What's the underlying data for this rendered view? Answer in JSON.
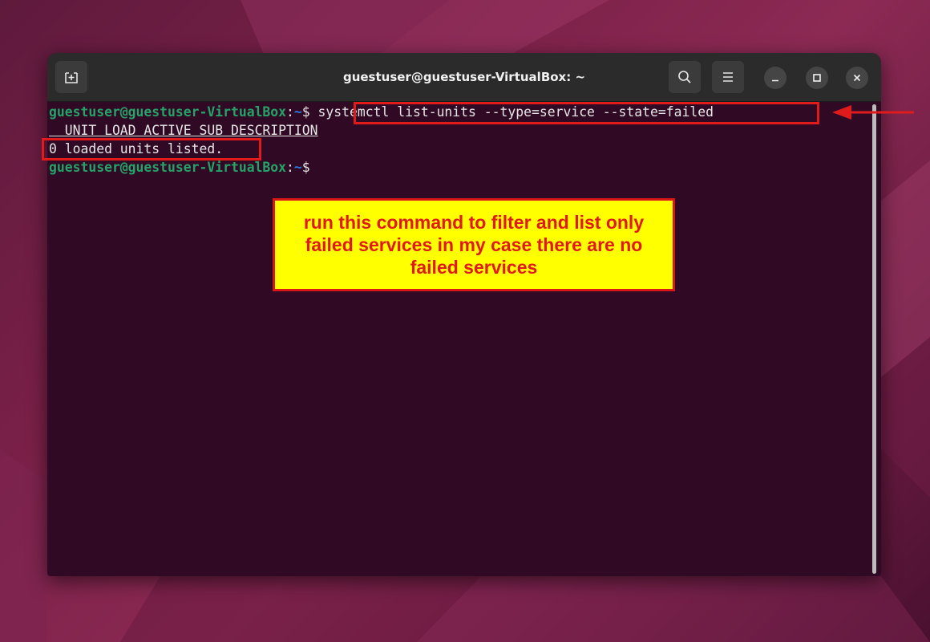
{
  "titlebar": {
    "title": "guestuser@guestuser-VirtualBox: ~",
    "new_tab_icon": "new-tab-icon",
    "search_icon": "search-icon",
    "menu_icon": "hamburger-menu-icon",
    "minimize_icon": "minimize-icon",
    "maximize_icon": "maximize-icon",
    "close_icon": "close-icon"
  },
  "terminal": {
    "prompt_user": "guestuser@guestuser-VirtualBox",
    "prompt_colon": ":",
    "prompt_path": "~",
    "prompt_symbol": "$",
    "command": "systemctl list-units --type=service --state=failed",
    "header": "  UNIT LOAD ACTIVE SUB DESCRIPTION",
    "result": "0 loaded units listed."
  },
  "annotation": {
    "callout_text": "run this command to filter and list only failed services in my case there are no failed services",
    "highlight_color": "#e01b1b",
    "callout_bg": "#ffff00"
  },
  "colors": {
    "terminal_bg": "#300a24",
    "prompt_user": "#26a269",
    "prompt_path": "#2a7bde"
  }
}
